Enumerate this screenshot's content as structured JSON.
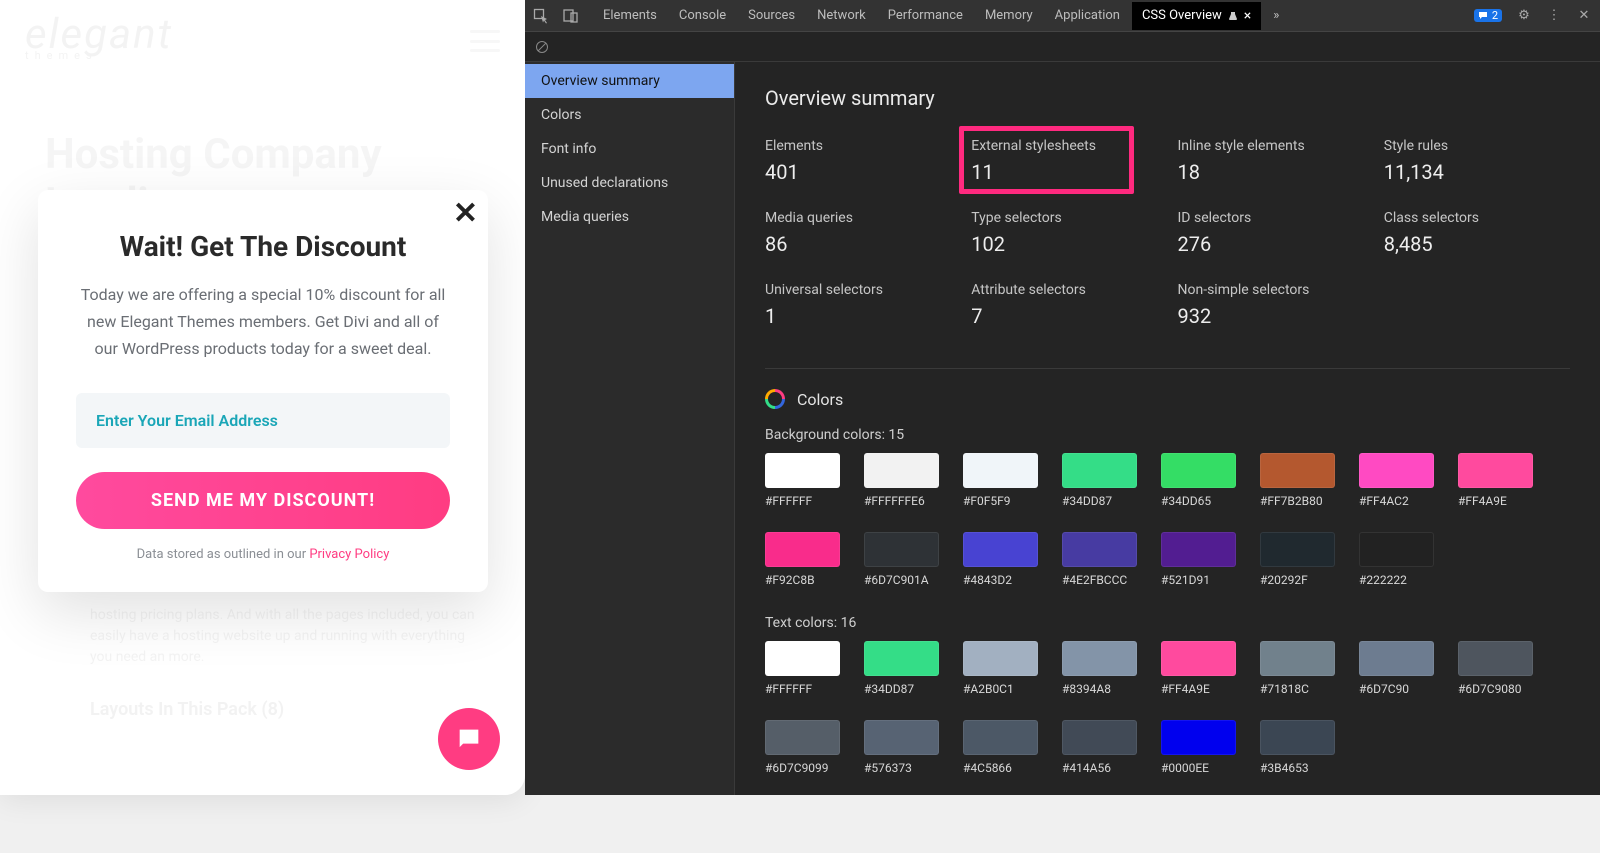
{
  "site": {
    "logo_line1": "elegant",
    "logo_line2": "themes",
    "heading": "Hosting Company Landing",
    "faded_body": "hosting pricing plans. And with all the pages included, you can easily have a hosting website up and running with everything you need an more.",
    "layouts_line": "Layouts In This Pack (8)"
  },
  "modal": {
    "title": "Wait! Get The Discount",
    "body": "Today we are offering a special 10% discount for all new Elegant Themes members. Get Divi and all of our WordPress products today for a sweet deal.",
    "email_placeholder": "Enter Your Email Address",
    "cta": "SEND ME MY DISCOUNT!",
    "privacy_prefix": "Data stored as outlined in our ",
    "privacy_link": "Privacy Policy"
  },
  "devtools": {
    "tabs": [
      "Elements",
      "Console",
      "Sources",
      "Network",
      "Performance",
      "Memory",
      "Application",
      "CSS Overview"
    ],
    "active_tab": "CSS Overview",
    "more_glyph": "»",
    "badge_count": "2",
    "sidebar": {
      "items": [
        "Overview summary",
        "Colors",
        "Font info",
        "Unused declarations",
        "Media queries"
      ],
      "active": "Overview summary"
    },
    "summary_title": "Overview summary",
    "stats": [
      {
        "label": "Elements",
        "value": "401"
      },
      {
        "label": "External stylesheets",
        "value": "11",
        "highlight": true
      },
      {
        "label": "Inline style elements",
        "value": "18"
      },
      {
        "label": "Style rules",
        "value": "11,134"
      },
      {
        "label": "Media queries",
        "value": "86"
      },
      {
        "label": "Type selectors",
        "value": "102"
      },
      {
        "label": "ID selectors",
        "value": "276"
      },
      {
        "label": "Class selectors",
        "value": "8,485"
      },
      {
        "label": "Universal selectors",
        "value": "1"
      },
      {
        "label": "Attribute selectors",
        "value": "7"
      },
      {
        "label": "Non-simple selectors",
        "value": "932"
      }
    ],
    "colors_title": "Colors",
    "bg_label": "Background colors: 15",
    "bg_colors": [
      {
        "hex": "#FFFFFF",
        "c": "#FFFFFF"
      },
      {
        "hex": "#FFFFFFE6",
        "c": "#F2F2F2"
      },
      {
        "hex": "#F0F5F9",
        "c": "#F0F5F9"
      },
      {
        "hex": "#34DD87",
        "c": "#34DD87"
      },
      {
        "hex": "#34DD65",
        "c": "#34DD65"
      },
      {
        "hex": "#FF7B2B80",
        "c": "#B4582F"
      },
      {
        "hex": "#FF4AC2",
        "c": "#FF4AC2"
      },
      {
        "hex": "#FF4A9E",
        "c": "#FF4A9E"
      },
      {
        "hex": "#F92C8B",
        "c": "#F92C8B"
      },
      {
        "hex": "#6D7C901A",
        "c": "#2E3236"
      },
      {
        "hex": "#4843D2",
        "c": "#4843D2"
      },
      {
        "hex": "#4E2FBCCC",
        "c": "#473BA2"
      },
      {
        "hex": "#521D91",
        "c": "#521D91"
      },
      {
        "hex": "#20292F",
        "c": "#20292F"
      },
      {
        "hex": "#222222",
        "c": "#222222"
      }
    ],
    "txt_label": "Text colors: 16",
    "txt_colors": [
      {
        "hex": "#FFFFFF",
        "c": "#FFFFFF"
      },
      {
        "hex": "#34DD87",
        "c": "#34DD87"
      },
      {
        "hex": "#A2B0C1",
        "c": "#A2B0C1"
      },
      {
        "hex": "#8394A8",
        "c": "#8394A8"
      },
      {
        "hex": "#FF4A9E",
        "c": "#FF4A9E"
      },
      {
        "hex": "#71818C",
        "c": "#71818C"
      },
      {
        "hex": "#6D7C90",
        "c": "#6D7C90"
      },
      {
        "hex": "#6D7C9080",
        "c": "#4E555E"
      },
      {
        "hex": "#6D7C9099",
        "c": "#555E68"
      },
      {
        "hex": "#576373",
        "c": "#576373"
      },
      {
        "hex": "#4C5866",
        "c": "#4C5866"
      },
      {
        "hex": "#414A56",
        "c": "#414A56"
      },
      {
        "hex": "#0000EE",
        "c": "#0000EE"
      },
      {
        "hex": "#3B4653",
        "c": "#3B4653"
      }
    ]
  }
}
